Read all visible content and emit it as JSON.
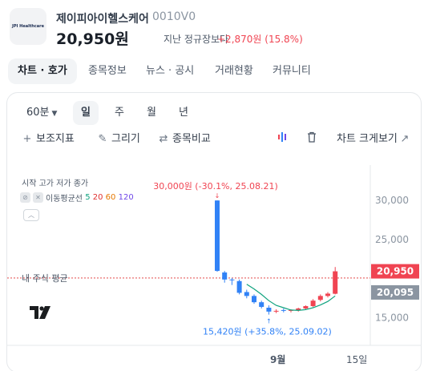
{
  "header": {
    "logo_text": "JPI Healthcare",
    "name": "제이피아이헬스케어",
    "code": "0010V0",
    "price": "20,950원",
    "compare_label": "지난 정규장보다",
    "change": "+2,870원 (15.8%)"
  },
  "tabs": [
    "차트 · 호가",
    "종목정보",
    "뉴스 · 공시",
    "거래현황",
    "커뮤니티"
  ],
  "periods": {
    "interval": "60분",
    "chevron_icon": "chevron-down-icon",
    "items": [
      "일",
      "주",
      "월",
      "년"
    ],
    "active": "일"
  },
  "toolbar": {
    "indicators": "보조지표",
    "draw": "그리기",
    "compare": "종목비교",
    "expand": "차트 크게보기"
  },
  "legend": {
    "ohlc": "시작 고가 저가 종가",
    "ma_label": "이동평균선",
    "ma_periods": [
      "5",
      "20",
      "60",
      "120"
    ]
  },
  "colors": {
    "up": "#f04452",
    "down": "#3182f6",
    "ma5": "#10a37f",
    "avg_line": "#e03131",
    "price_tag": "#f04452",
    "avg_tag": "#8b95a1"
  },
  "chart_data": {
    "type": "candlestick",
    "ylim": [
      12000,
      33500
    ],
    "y_ticks": [
      "30,000",
      "25,000",
      "15,000"
    ],
    "x_tick_labels": [
      "9월",
      "15일"
    ],
    "candles": [
      {
        "o": 30000,
        "h": 30000,
        "l": 20900,
        "c": 21000
      },
      {
        "o": 20800,
        "h": 21000,
        "l": 19500,
        "c": 19900
      },
      {
        "o": 19900,
        "h": 20100,
        "l": 19200,
        "c": 19800
      },
      {
        "o": 19700,
        "h": 19900,
        "l": 18000,
        "c": 18200
      },
      {
        "o": 18300,
        "h": 18600,
        "l": 17500,
        "c": 17800
      },
      {
        "o": 17800,
        "h": 18000,
        "l": 16800,
        "c": 17000
      },
      {
        "o": 17000,
        "h": 17200,
        "l": 16200,
        "c": 16400
      },
      {
        "o": 16300,
        "h": 16600,
        "l": 15420,
        "c": 15800
      },
      {
        "o": 15800,
        "h": 16100,
        "l": 15600,
        "c": 15900
      },
      {
        "o": 16000,
        "h": 16200,
        "l": 15700,
        "c": 15900
      },
      {
        "o": 15900,
        "h": 16100,
        "l": 15700,
        "c": 16000
      },
      {
        "o": 16000,
        "h": 16300,
        "l": 15800,
        "c": 16200
      },
      {
        "o": 16200,
        "h": 16600,
        "l": 16000,
        "c": 16500
      },
      {
        "o": 16500,
        "h": 17400,
        "l": 16400,
        "c": 17200
      },
      {
        "o": 17300,
        "h": 18000,
        "l": 17100,
        "c": 17800
      },
      {
        "o": 17800,
        "h": 18300,
        "l": 17600,
        "c": 18100
      },
      {
        "o": 18080,
        "h": 21500,
        "l": 18000,
        "c": 20950
      }
    ],
    "ma5": [
      null,
      null,
      null,
      null,
      19300,
      18700,
      18000,
      17200,
      16600,
      16300,
      16000,
      15950,
      16050,
      16300,
      16650,
      17100,
      17800
    ],
    "max_note": "30,000원 (-30.1%, 25.08.21)",
    "min_note": "15,420원 (+35.8%, 25.09.02)",
    "current_price_tag": "20,950",
    "avg_label": "내 주식 평균",
    "avg_price": 20095,
    "avg_price_tag": "20,095"
  }
}
